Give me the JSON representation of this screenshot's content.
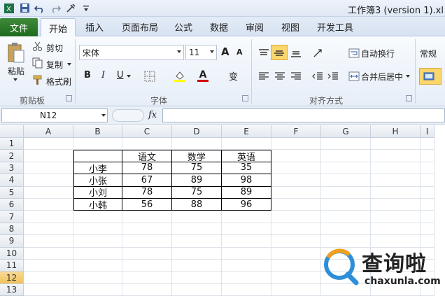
{
  "window": {
    "title": "工作簿3 (version 1).xl"
  },
  "ribbon_tabs": [
    "文件",
    "开始",
    "插入",
    "页面布局",
    "公式",
    "数据",
    "审阅",
    "视图",
    "开发工具"
  ],
  "clipboard": {
    "paste": "粘贴",
    "cut": "剪切",
    "copy": "复制",
    "format_painter": "格式刷",
    "group": "剪贴板"
  },
  "font": {
    "name": "宋体",
    "size": "11",
    "group": "字体",
    "bold": "B",
    "italic": "I",
    "underline": "U",
    "grow": "A",
    "shrink": "A",
    "font_color": "A",
    "wen": "变"
  },
  "alignment": {
    "wrap": "自动换行",
    "merge": "合并后居中",
    "group": "对齐方式"
  },
  "number": {
    "format": "常规"
  },
  "formula_bar": {
    "name_box": "N12",
    "fx": "fx",
    "value": ""
  },
  "columns": [
    "A",
    "B",
    "C",
    "D",
    "E",
    "F",
    "G",
    "H",
    "I"
  ],
  "rows": [
    "1",
    "2",
    "3",
    "4",
    "5",
    "6",
    "7",
    "8",
    "9",
    "10",
    "11",
    "12",
    "13"
  ],
  "selected_row": "12",
  "table": {
    "header": [
      "",
      "语文",
      "数学",
      "英语"
    ],
    "rows": [
      [
        "小李",
        "78",
        "75",
        "35"
      ],
      [
        "小张",
        "67",
        "89",
        "98"
      ],
      [
        "小刘",
        "78",
        "75",
        "89"
      ],
      [
        "小韩",
        "56",
        "88",
        "96"
      ]
    ]
  },
  "watermark": {
    "cn": "查询啦",
    "en": "chaxunla.com"
  },
  "colors": {
    "file_tab": "#2a7a2a",
    "selection": "#f1c25a",
    "accent_red": "#d00000"
  }
}
